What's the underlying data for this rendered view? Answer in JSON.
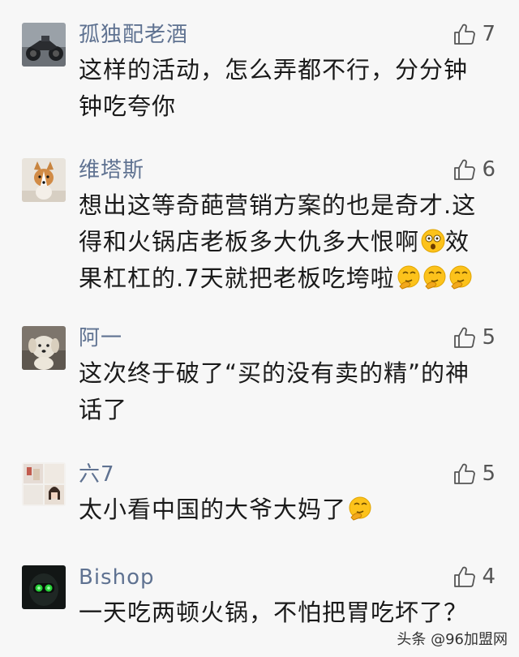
{
  "comments": [
    {
      "author": "孤独配老酒",
      "likes": "7",
      "lines": [
        "这样的活动，怎么弄都不行，分分钟",
        "钟吃夸你"
      ],
      "avatar_icon": "motorcycle-avatar"
    },
    {
      "author": "维塔斯",
      "likes": "6",
      "lines": [
        "想出这等奇葩营销方案的也是奇才.这",
        "得和火锅店老板多大仇多大恨啊",
        "效",
        "果杠杠的.7天就把老板吃垮啦"
      ],
      "avatar_icon": "corgi-avatar",
      "emoji_icons": [
        "shocked-face-emoji",
        "thinking-face-emoji"
      ]
    },
    {
      "author": "阿一",
      "likes": "5",
      "lines": [
        "这次终于破了“买的没有卖的精”的神",
        "话了"
      ],
      "avatar_icon": "puppy-avatar"
    },
    {
      "author": "六7",
      "likes": "5",
      "lines": [
        "太小看中国的大爷大妈了"
      ],
      "avatar_icon": "collage-avatar",
      "emoji_icons": [
        "thinking-face-emoji"
      ]
    },
    {
      "author": "Bishop",
      "likes": "4",
      "lines": [
        "一天吃两顿火锅，不怕把胃吃坏了？"
      ],
      "avatar_icon": "night-vision-avatar"
    }
  ],
  "watermark": "头条 @96加盟网",
  "colors": {
    "author": "#5f7291",
    "text": "#1a1a1a",
    "background": "#f7f7f7"
  }
}
